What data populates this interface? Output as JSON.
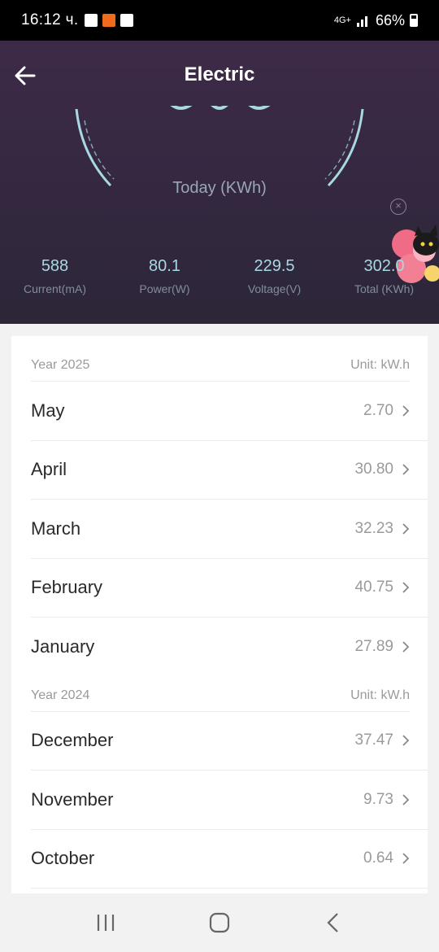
{
  "status_bar": {
    "time": "16:12 ч.",
    "network": "4G+",
    "battery": "66%"
  },
  "header": {
    "title": "Electric",
    "gauge_label": "Today (KWh)",
    "stats": [
      {
        "value": "588",
        "label": "Current(mA)"
      },
      {
        "value": "80.1",
        "label": "Power(W)"
      },
      {
        "value": "229.5",
        "label": "Voltage(V)"
      },
      {
        "value": "302.0",
        "label": "Total (KWh)"
      }
    ]
  },
  "history": {
    "years": [
      {
        "year_label": "Year 2025",
        "unit_label": "Unit: kW.h",
        "months": [
          {
            "name": "May",
            "value": "2.70"
          },
          {
            "name": "April",
            "value": "30.80"
          },
          {
            "name": "March",
            "value": "32.23"
          },
          {
            "name": "February",
            "value": "40.75"
          },
          {
            "name": "January",
            "value": "27.89"
          }
        ]
      },
      {
        "year_label": "Year 2024",
        "unit_label": "Unit: kW.h",
        "months": [
          {
            "name": "December",
            "value": "37.47"
          },
          {
            "name": "November",
            "value": "9.73"
          },
          {
            "name": "October",
            "value": "0.64"
          }
        ]
      }
    ]
  },
  "icons": {
    "back": "arrow-left-icon",
    "chevron": "chevron-right-icon",
    "nav_recents": "recents-icon",
    "nav_home": "home-icon",
    "nav_back": "back-icon"
  },
  "colors": {
    "header_bg": "#33283f",
    "gauge_arc": "#a8d8e3",
    "stat_value": "#a8d8e3"
  }
}
